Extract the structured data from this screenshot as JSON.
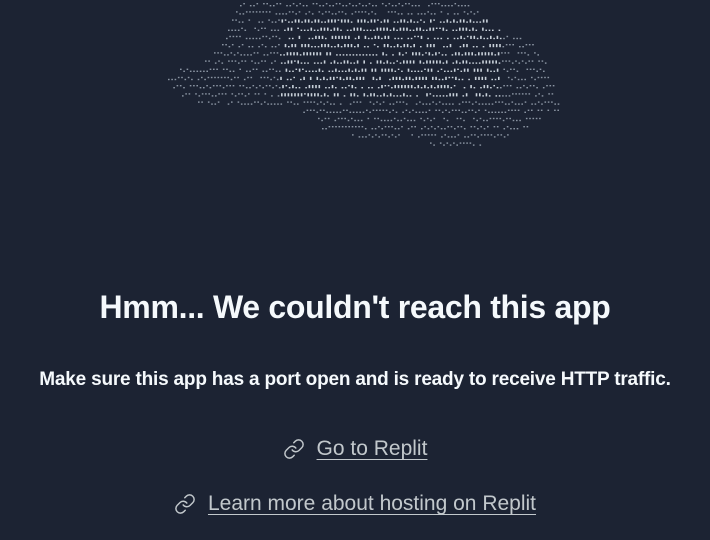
{
  "title": "Hmm... We couldn't reach this app",
  "subtitle": "Make sure this app has a port open and is ready to receive HTTP traffic.",
  "links": {
    "go_to_replit": "Go to Replit",
    "learn_more": "Learn more about hosting on Replit"
  },
  "icons": {
    "link": "link-icon"
  },
  "colors": {
    "background": "#1c2333",
    "text": "#f5f9fc",
    "link": "#c2c8cc",
    "art": "#9aa4b2"
  }
}
